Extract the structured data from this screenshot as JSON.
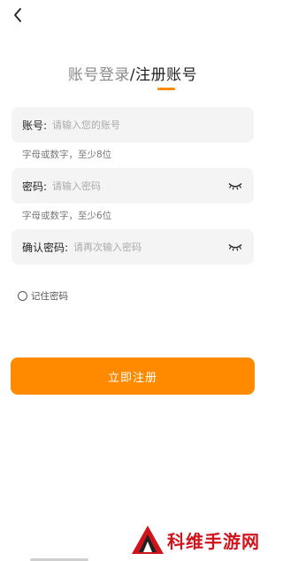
{
  "header": {
    "title_inactive": "账号登录",
    "title_separator": "/",
    "title_active": "注册账号",
    "accent_color": "#ff8a00"
  },
  "form": {
    "account": {
      "label": "账号:",
      "placeholder": "请输入您的账号",
      "hint": "字母或数字，至少8位"
    },
    "password": {
      "label": "密码:",
      "placeholder": "请输入密码",
      "hint": "字母或数字，至少6位",
      "toggle_icon": "eye-closed-icon"
    },
    "confirm": {
      "label": "确认密码:",
      "placeholder": "请再次输入密码",
      "toggle_icon": "eye-closed-icon"
    },
    "remember_label": "记住密码",
    "submit_label": "立即注册"
  },
  "watermark": {
    "text": "科维手游网"
  }
}
